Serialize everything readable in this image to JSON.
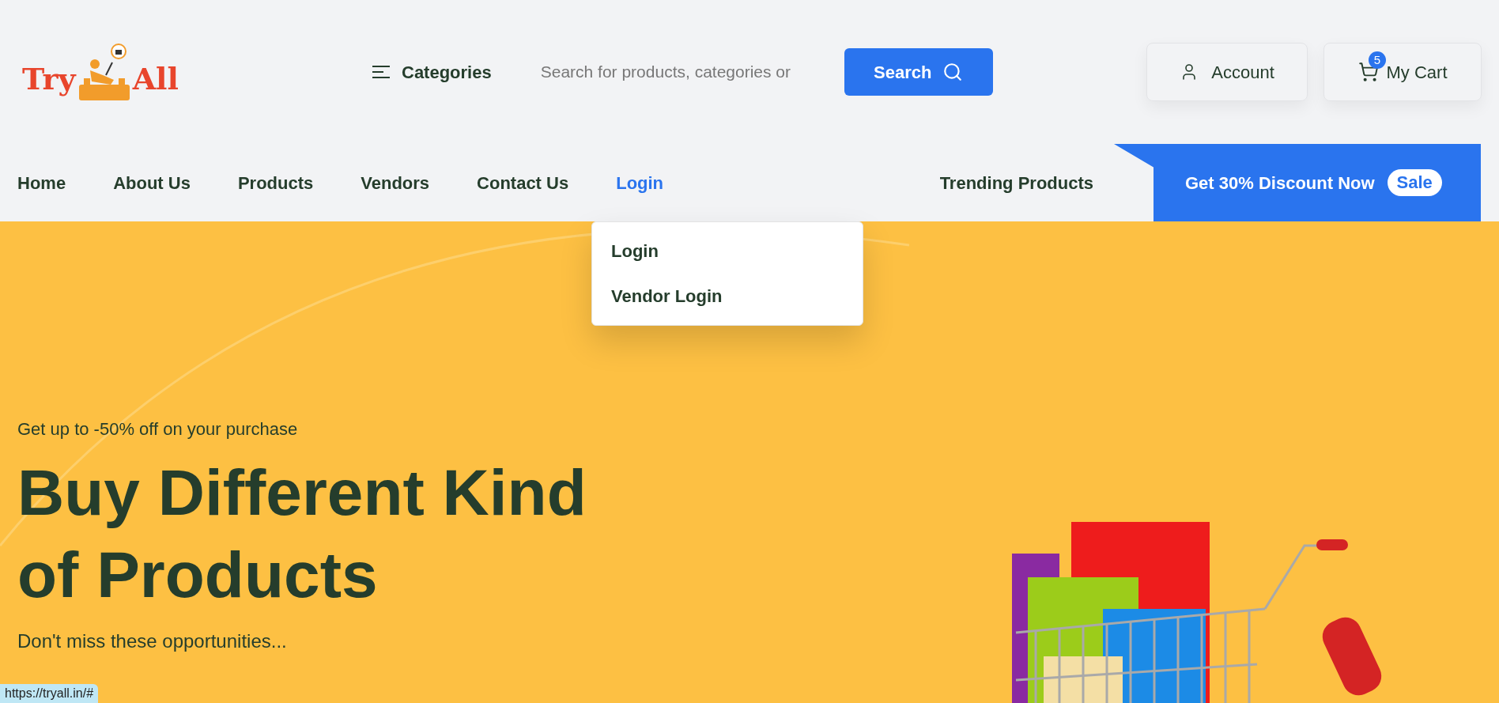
{
  "logo": {
    "left": "Try",
    "right": "All"
  },
  "categories": {
    "label": "Categories"
  },
  "search": {
    "placeholder": "Search for products, categories or",
    "button": "Search"
  },
  "account": {
    "label": "Account"
  },
  "cart": {
    "label": "My Cart",
    "count": "5"
  },
  "nav": [
    {
      "label": "Home",
      "selected": false
    },
    {
      "label": "About Us",
      "selected": false
    },
    {
      "label": "Products",
      "selected": false
    },
    {
      "label": "Vendors",
      "selected": false
    },
    {
      "label": "Contact Us",
      "selected": false
    },
    {
      "label": "Login",
      "selected": true
    }
  ],
  "login_menu": [
    "Login",
    "Vendor Login"
  ],
  "trending": "Trending Products",
  "promo": {
    "text": "Get 30% Discount Now",
    "badge": "Sale"
  },
  "hero": {
    "kicker": "Get up to -50% off on your purchase",
    "title_lines": [
      "Buy Different Kind",
      "of Products"
    ],
    "subtitle": "Don't miss these opportunities..."
  },
  "status_url": "https://tryall.in/#"
}
